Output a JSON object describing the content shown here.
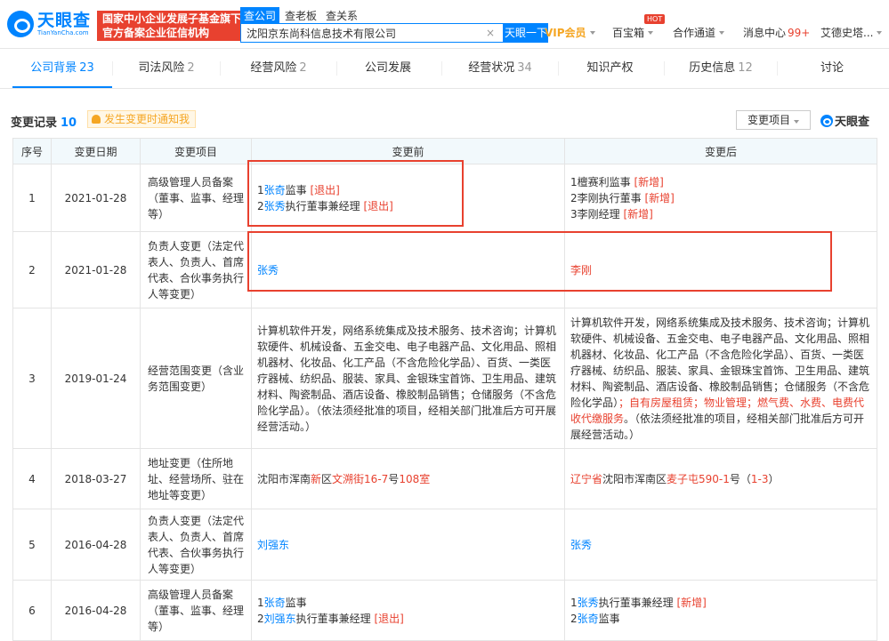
{
  "header": {
    "logo_cn": "天眼查",
    "logo_en": "TianYanCha.com",
    "banner_line1": "国家中小企业发展子基金旗下",
    "banner_line2": "官方备案企业征信机构",
    "search_tabs": [
      "查公司",
      "查老板",
      "查关系"
    ],
    "search_value": "沈阳京东尚科信息技术有限公司",
    "clear_glyph": "×",
    "search_button": "天眼一下",
    "vip": "VIP会员",
    "treasure": "百宝箱",
    "hot_badge": "HOT",
    "cooperation": "合作通道",
    "messages": "消息中心",
    "messages_count": "99+",
    "user": "艾德史塔..."
  },
  "tabs": [
    {
      "label": "公司背景",
      "count": "23"
    },
    {
      "label": "司法风险",
      "count": "2"
    },
    {
      "label": "经营风险",
      "count": "2"
    },
    {
      "label": "公司发展",
      "count": ""
    },
    {
      "label": "经营状况",
      "count": "34"
    },
    {
      "label": "知识产权",
      "count": ""
    },
    {
      "label": "历史信息",
      "count": "12"
    },
    {
      "label": "讨论",
      "count": ""
    }
  ],
  "section": {
    "title": "变更记录",
    "count": "10",
    "notify": "发生变更时通知我",
    "filter": "变更项目",
    "brand": "天眼查"
  },
  "table": {
    "headers": [
      "序号",
      "变更日期",
      "变更项目",
      "变更前",
      "变更后"
    ],
    "rows": [
      {
        "idx": "1",
        "date": "2021-01-28",
        "item": "高级管理人员备案（董事、监事、经理等）",
        "before": [
          [
            {
              "t": "1"
            },
            {
              "t": "张奇",
              "c": "lk"
            },
            {
              "t": "监事 "
            },
            {
              "t": "[退出]",
              "c": "rd"
            }
          ],
          [
            {
              "t": "2"
            },
            {
              "t": "张秀",
              "c": "lk"
            },
            {
              "t": "执行董事兼经理 "
            },
            {
              "t": "[退出]",
              "c": "rd"
            }
          ]
        ],
        "after": [
          [
            {
              "t": "1檀赛利监事 "
            },
            {
              "t": "[新增]",
              "c": "rd"
            }
          ],
          [
            {
              "t": "2李刚执行董事 "
            },
            {
              "t": "[新增]",
              "c": "rd"
            }
          ],
          [
            {
              "t": "3李刚经理 "
            },
            {
              "t": "[新增]",
              "c": "rd"
            }
          ]
        ]
      },
      {
        "idx": "2",
        "date": "2021-01-28",
        "item": "负责人变更（法定代表人、负责人、首席代表、合伙事务执行人等变更）",
        "before": [
          [
            {
              "t": "张秀",
              "c": "lk"
            }
          ]
        ],
        "after": [
          [
            {
              "t": "李刚",
              "c": "hl"
            }
          ]
        ]
      },
      {
        "idx": "3",
        "date": "2019-01-24",
        "item": "经营范围变更（含业务范围变更）",
        "before": [
          [
            {
              "t": "计算机软件开发，网络系统集成及技术服务、技术咨询；计算机软硬件、机械设备、五金交电、电子电器产品、文化用品、照相机器材、化妆品、化工产品（不含危险化学品）、百货、一类医疗器械、纺织品、服装、家具、金银珠宝首饰、卫生用品、建筑材料、陶瓷制品、酒店设备、橡胶制品销售；仓储服务（不含危险化学品）。（依法须经批准的项目，经相关部门批准后方可开展经营活动。）"
            }
          ]
        ],
        "after": [
          [
            {
              "t": "计算机软件开发，网络系统集成及技术服务、技术咨询；计算机软硬件、机械设备、五金交电、电子电器产品、文化用品、照相机器材、化妆品、化工产品（不含危险化学品）、百货、一类医疗器械、纺织品、服装、家具、金银珠宝首饰、卫生用品、建筑材料、陶瓷制品、酒店设备、橡胶制品销售；仓储服务（不含危险化学品）"
            },
            {
              "t": "；自有房屋租赁；物业管理；燃气费、水费、电费代收代缴服务",
              "c": "hl"
            },
            {
              "t": "。（依法须经批准的项目，经相关部门批准后方可开展经营活动。）"
            }
          ]
        ]
      },
      {
        "idx": "4",
        "date": "2018-03-27",
        "item": "地址变更（住所地址、经营场所、驻在地址等变更）",
        "before": [
          [
            {
              "t": "沈阳市浑南"
            },
            {
              "t": "新",
              "c": "hl"
            },
            {
              "t": "区"
            },
            {
              "t": "文溯街16-7",
              "c": "hl"
            },
            {
              "t": "号"
            },
            {
              "t": "108室",
              "c": "hl"
            }
          ]
        ],
        "after": [
          [
            {
              "t": "辽宁省",
              "c": "hl"
            },
            {
              "t": "沈阳市浑南区"
            },
            {
              "t": "麦子屯590-1",
              "c": "hl"
            },
            {
              "t": "号（"
            },
            {
              "t": "1-3",
              "c": "hl"
            },
            {
              "t": "）"
            }
          ]
        ]
      },
      {
        "idx": "5",
        "date": "2016-04-28",
        "item": "负责人变更（法定代表人、负责人、首席代表、合伙事务执行人等变更）",
        "before": [
          [
            {
              "t": "刘强东",
              "c": "lk"
            }
          ]
        ],
        "after": [
          [
            {
              "t": "张秀",
              "c": "lk"
            }
          ]
        ]
      },
      {
        "idx": "6",
        "date": "2016-04-28",
        "item": "高级管理人员备案（董事、监事、经理等）",
        "before": [
          [
            {
              "t": "1"
            },
            {
              "t": "张奇",
              "c": "lk"
            },
            {
              "t": "监事"
            }
          ],
          [
            {
              "t": "2"
            },
            {
              "t": "刘强东",
              "c": "lk"
            },
            {
              "t": "执行董事兼经理 "
            },
            {
              "t": "[退出]",
              "c": "rd"
            }
          ]
        ],
        "after": [
          [
            {
              "t": "1"
            },
            {
              "t": "张秀",
              "c": "lk"
            },
            {
              "t": "执行董事兼经理 "
            },
            {
              "t": "[新增]",
              "c": "rd"
            }
          ],
          [
            {
              "t": "2"
            },
            {
              "t": "张奇",
              "c": "lk"
            },
            {
              "t": "监事"
            }
          ]
        ]
      }
    ]
  },
  "colors": {
    "brand": "#0084ff",
    "red": "#e8412f",
    "orange": "#f5a623",
    "header_bg": "#f2f9fc"
  }
}
